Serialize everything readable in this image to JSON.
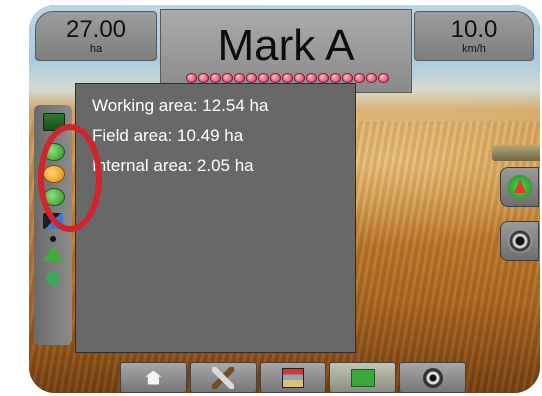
{
  "header": {
    "left_stat": {
      "value": "27.00",
      "unit": "ha"
    },
    "mark": {
      "title": "Mark A"
    },
    "right_stat": {
      "value": "10.0",
      "unit": "km/h"
    }
  },
  "boom_sections": {
    "count": 17,
    "color": "#e0406a"
  },
  "info_panel": {
    "working_area": "Working area: 12.54 ha",
    "field_area": "Field area: 10.49 ha",
    "internal_area": "Internal area: 2.05 ha"
  },
  "left_toolbar": {
    "icons": [
      "boundary-square-icon",
      "area-info-green-icon",
      "area-info-orange-icon",
      "area-info-green-icon",
      "swath-bar-icon",
      "marker-dot-icon",
      "guidance-triangle-icon",
      "droplet-icon"
    ]
  },
  "right_buttons": [
    "navigation-icon",
    "camera-icon"
  ],
  "bottom_dock": [
    "home-icon",
    "tools-icon",
    "vehicle-view-icon",
    "field-marker-icon",
    "camera-icon"
  ],
  "highlight": {
    "color": "#d3232d"
  }
}
